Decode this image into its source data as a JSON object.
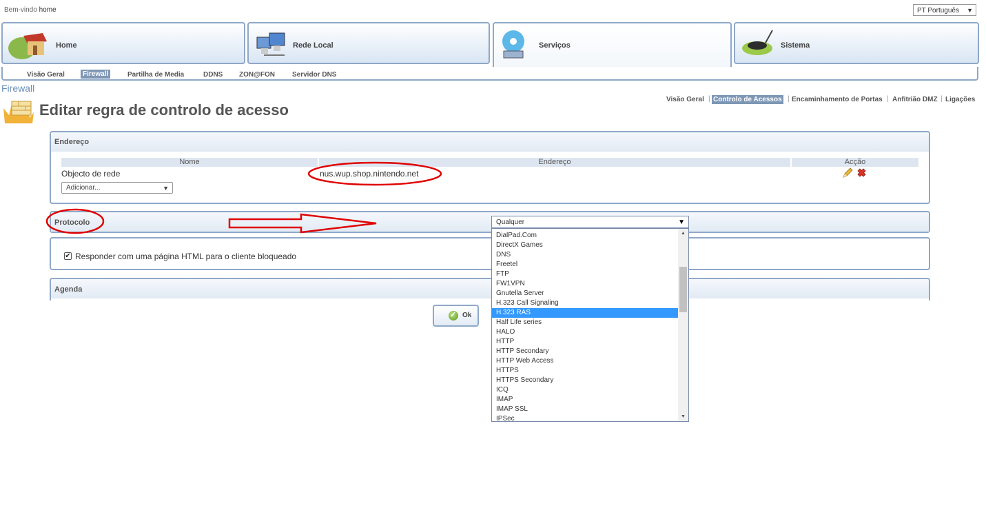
{
  "header": {
    "welcome_text": "Bem-vindo",
    "welcome_user": "home",
    "language": "PT Português"
  },
  "main_tabs": [
    {
      "label": "Home",
      "icon": "house-icon"
    },
    {
      "label": "Rede Local",
      "icon": "network-computers-icon"
    },
    {
      "label": "Serviços",
      "icon": "services-disc-icon",
      "active": true
    },
    {
      "label": "Sistema",
      "icon": "router-icon"
    }
  ],
  "sub_nav": [
    "Visão Geral",
    "Firewall",
    "Partilha de Media",
    "DDNS",
    "ZON@FON",
    "Servidor DNS"
  ],
  "sub_nav_active": "Firewall",
  "breadcrumb": "Firewall",
  "page_title": "Editar regra de controlo de acesso",
  "section_links": [
    "Visão Geral",
    "Controlo de Acessos",
    "Encaminhamento de Portas",
    "Anfitrião DMZ",
    "Ligações"
  ],
  "section_links_active": "Controlo de Acessos",
  "address_panel": {
    "title": "Endereço",
    "columns": [
      "Nome",
      "Endereço",
      "Acção"
    ],
    "row": {
      "name": "Objecto de rede",
      "address": "nus.wup.shop.nintendo.net"
    },
    "add_select": "Adicionar..."
  },
  "protocol_panel": {
    "title": "Protocolo",
    "selected_value": "Qualquer",
    "options": [
      "DialPad.Com",
      "DirectX Games",
      "DNS",
      "Freetel",
      "FTP",
      "FW1VPN",
      "Gnutella Server",
      "H.323 Call Signaling",
      "H.323 RAS",
      "Half Life series",
      "HALO",
      "HTTP",
      "HTTP Secondary",
      "HTTP Web Access",
      "HTTPS",
      "HTTPS Secondary",
      "ICQ",
      "IMAP",
      "IMAP SSL",
      "IPSec"
    ],
    "highlighted_option": "H.323 RAS"
  },
  "block_panel": {
    "checkbox_label": "Responder com uma página HTML para o cliente bloqueado",
    "checked": true
  },
  "schedule_panel": {
    "title": "Agenda"
  },
  "ok_button": "Ok",
  "annotation_color": "#e00000"
}
